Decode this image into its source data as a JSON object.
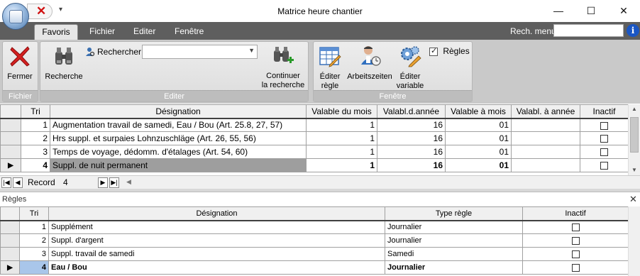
{
  "window": {
    "title": "Matrice heure chantier",
    "minimize_glyph": "—",
    "maximize_glyph": "☐",
    "close_glyph": "✕"
  },
  "quick_access": {
    "cancel_glyph": "✕",
    "dropdown_glyph": "▾"
  },
  "ribbon_tabs": [
    "Favoris",
    "Fichier",
    "Editer",
    "Fenêtre"
  ],
  "menu_search": {
    "label": "Rech. menu",
    "value": "",
    "info_glyph": "i"
  },
  "ribbon": {
    "fichier": {
      "group_label": "Fichier",
      "fermer": "Fermer"
    },
    "editer": {
      "group_label": "Editer",
      "recherche": "Recherche",
      "rechercher_label": "Rechercher",
      "rechercher_value": "",
      "continuer_line1": "Continuer",
      "continuer_line2": "la recherche"
    },
    "fenetre": {
      "group_label": "Fenêtre",
      "editer_regle_line1": "Éditer",
      "editer_regle_line2": "règle",
      "arbeitszeiten": "Arbeitszeiten",
      "editer_variable_line1": "Éditer",
      "editer_variable_line2": "variable",
      "regles_checkbox": "Règles",
      "regles_checked": true
    }
  },
  "grid_main": {
    "columns": [
      "Tri",
      "Désignation",
      "Valable du mois",
      "Valabl.d.année",
      "Valable à mois",
      "Valabl. à année",
      "Inactif"
    ],
    "rows": [
      {
        "tri": "1",
        "designation": "Augmentation travail de samedi, Eau / Bou (Art. 25.8, 27, 57)",
        "valable_du_mois": "1",
        "valabl_d_annee": "16",
        "valable_a_mois": "01",
        "valabl_a_annee": "",
        "inactif": false
      },
      {
        "tri": "2",
        "designation": "Hrs suppl. et surpaies Lohnzuschläge (Art. 26, 55, 56)",
        "valable_du_mois": "1",
        "valabl_d_annee": "16",
        "valable_a_mois": "01",
        "valabl_a_annee": "",
        "inactif": false
      },
      {
        "tri": "3",
        "designation": "Temps de voyage, dédomm. d'étalages (Art. 54, 60)",
        "valable_du_mois": "1",
        "valabl_d_annee": "16",
        "valable_a_mois": "01",
        "valabl_a_annee": "",
        "inactif": false
      },
      {
        "tri": "4",
        "designation": "Suppl. de nuit permanent",
        "valable_du_mois": "1",
        "valabl_d_annee": "16",
        "valable_a_mois": "01",
        "valabl_a_annee": "",
        "inactif": false
      }
    ],
    "current_row_marker": "▶",
    "navigator": {
      "label": "Record",
      "value": "4"
    }
  },
  "panel_regles": {
    "title": "Règles",
    "close_glyph": "✕",
    "columns": [
      "Tri",
      "Désignation",
      "Type règle",
      "Inactif"
    ],
    "rows": [
      {
        "tri": "1",
        "designation": "Supplément",
        "type_regle": "Journalier",
        "inactif": false
      },
      {
        "tri": "2",
        "designation": "Suppl. d'argent",
        "type_regle": "Journalier",
        "inactif": false
      },
      {
        "tri": "3",
        "designation": "Suppl. travail de samedi",
        "type_regle": "Samedi",
        "inactif": false
      },
      {
        "tri": "4",
        "designation": "Eau / Bou",
        "type_regle": "Journalier",
        "inactif": false
      }
    ]
  }
}
